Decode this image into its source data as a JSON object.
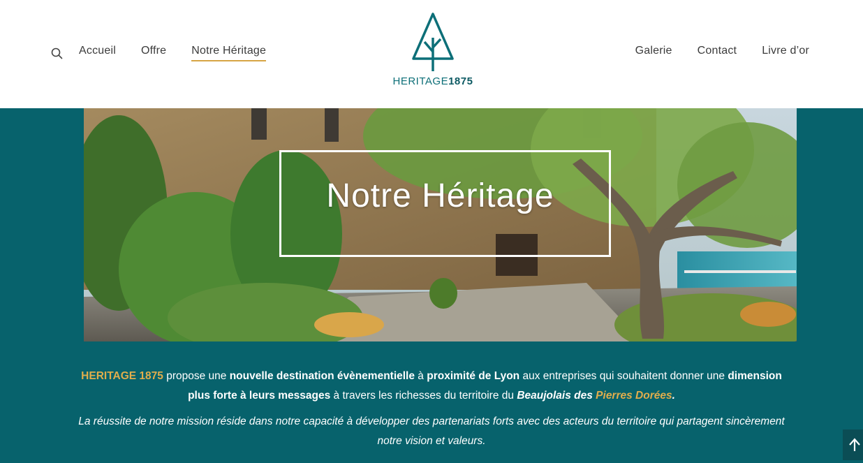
{
  "nav": {
    "left": [
      "Accueil",
      "Offre",
      "Notre Héritage"
    ],
    "right": [
      "Galerie",
      "Contact",
      "Livre d’or"
    ],
    "active": "Notre Héritage"
  },
  "logo": {
    "word": "HERITAGE",
    "year": "1875"
  },
  "hero": {
    "title": "Notre Héritage"
  },
  "intro": {
    "brand": "HERITAGE 1875",
    "t1": " propose une ",
    "b1": "nouvelle destination évènementielle",
    "t2": " à ",
    "b2": "proximité de Lyon",
    "t3": " aux entreprises qui souhaitent donner une ",
    "b3": "dimension plus forte à leurs messages",
    "t4": " à travers les richesses du territoire du ",
    "bi1": "Beaujolais des ",
    "gi1": "Pierres Dorées",
    "bi2": "."
  },
  "mission": {
    "text": "La réussite de notre mission réside dans notre capacité à développer des partenariats forts avec des acteurs du territoire qui partagent sincèrement notre vision et valeurs."
  },
  "colors": {
    "teal": "#07626c",
    "gold": "#e0ad4c",
    "underline": "#d7a544"
  }
}
